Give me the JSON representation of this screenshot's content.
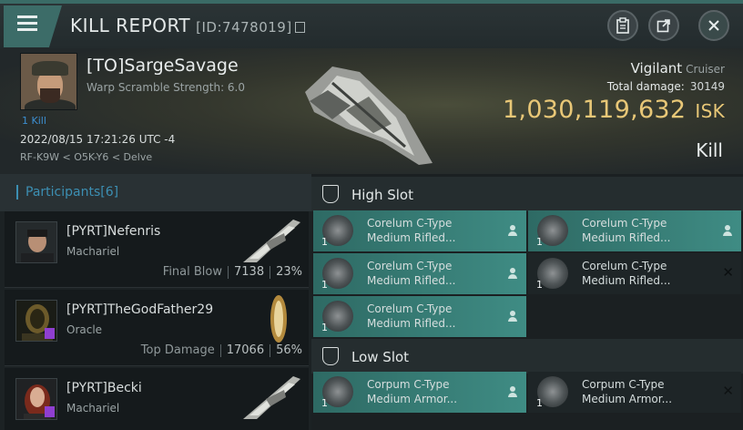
{
  "header": {
    "title": "KILL REPORT",
    "id_text": "[ID:7478019]",
    "buttons": [
      "clipboard-icon",
      "external-link-icon",
      "close-icon"
    ]
  },
  "victim": {
    "name": "[TO]SargeSavage",
    "warp_scramble": "Warp Scramble Strength: 6.0",
    "kill_count": "1 Kill",
    "date": "2022/08/15 17:21:26 UTC -4",
    "location": "RF-K9W < O5K-Y6 < Delve",
    "ship": "Vigilant",
    "ship_class": "Cruiser",
    "total_damage_label": "Total damage:",
    "total_damage": "30149",
    "isk_value": "1,030,119,632",
    "isk_unit": "ISK",
    "result": "Kill"
  },
  "participants": {
    "title": "Participants",
    "count": "[6]",
    "rows": [
      {
        "name": "[PYRT]Nefenris",
        "ship": "Machariel",
        "label": "Final Blow",
        "damage": "7138",
        "percent": "23%"
      },
      {
        "name": "[PYRT]TheGodFather29",
        "ship": "Oracle",
        "label": "Top Damage",
        "damage": "17066",
        "percent": "56%"
      },
      {
        "name": "[PYRT]Becki",
        "ship": "Machariel",
        "label": "",
        "damage": "",
        "percent": ""
      }
    ]
  },
  "slots": {
    "high": {
      "title": "High Slot",
      "items": [
        {
          "qty": "1",
          "line1": "Corelum C-Type",
          "line2": "Medium Rifled...",
          "status": "dropped"
        },
        {
          "qty": "1",
          "line1": "Corelum C-Type",
          "line2": "Medium Rifled...",
          "status": "dropped"
        },
        {
          "qty": "1",
          "line1": "Corelum C-Type",
          "line2": "Medium Rifled...",
          "status": "dropped"
        },
        {
          "qty": "1",
          "line1": "Corelum C-Type",
          "line2": "Medium Rifled...",
          "status": "destroyed"
        },
        {
          "qty": "1",
          "line1": "Corelum C-Type",
          "line2": "Medium Rifled...",
          "status": "dropped"
        }
      ]
    },
    "low": {
      "title": "Low Slot",
      "items": [
        {
          "qty": "1",
          "line1": "Corpum C-Type",
          "line2": "Medium Armor...",
          "status": "dropped"
        },
        {
          "qty": "1",
          "line1": "Corpum C-Type",
          "line2": "Medium Armor...",
          "status": "destroyed"
        }
      ]
    }
  },
  "colors": {
    "accent": "#3c6c68",
    "isk": "#e8c777",
    "dropped": "#3f8c84",
    "link": "#3c8fb3"
  }
}
